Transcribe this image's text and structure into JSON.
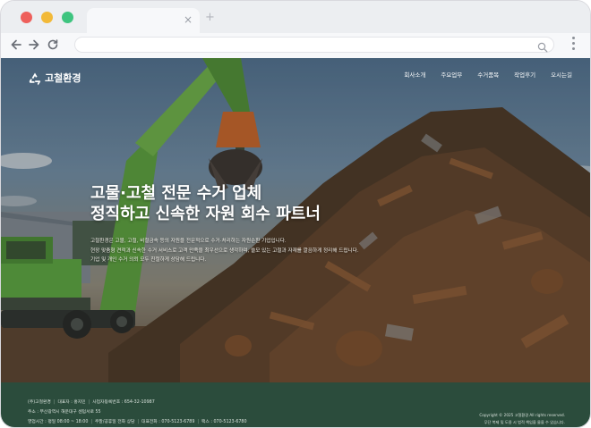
{
  "browser": {
    "tab_close": "×",
    "tab_new": "+",
    "address_value": "",
    "colors": {
      "chrome": "#eceef1",
      "red": "#ee5f5b",
      "yellow": "#f2b938",
      "green": "#3ec47f"
    }
  },
  "site": {
    "logo_text": "고철환경",
    "logo_icon": "recycle-icon",
    "nav": [
      "회사소개",
      "주요업무",
      "수거품목",
      "작업후기",
      "오시는길"
    ]
  },
  "hero": {
    "title_line1": "고물·고철 전문 수거 업체",
    "title_line2": "정직하고 신속한 자원 회수 파트너",
    "desc_line1": "고철환경은 고물, 고철, 비철금속 등의 자원을 전문적으로 수거·처리하는 자원순환 기업입니다.",
    "desc_line2": "현장 맞춤형 견적과 신속한 수거 서비스로 고객 만족을 최우선으로 생각하며, 쓸모 있는 고철과 자재를 깔끔하게 정리해 드립니다.",
    "desc_line3": "기업 및 개인 수거 의뢰 모두 친절하게 상담해 드립니다."
  },
  "footer": {
    "company": "(주)고철환경",
    "ceo": "대표자 : 홍지민",
    "biz_no": "사업자등록번호 : 654-32-10987",
    "address": "주소 : 부산광역시 해운대구 센텀서로 55",
    "hours": "영업시간 : 평일 08:00 ~ 18:00",
    "holiday": "주말/공휴일 전화 상담",
    "phone": "대표전화 : 070-5123-6789",
    "fax": "팩스 : 070-5123-6780",
    "copyright": "Copyright © 2025 고철환경 All rights reserved.",
    "notice": "무단 복제 및 도용 시 법적 책임을 물을 수 있습니다.",
    "color": "#2b4c3c"
  }
}
